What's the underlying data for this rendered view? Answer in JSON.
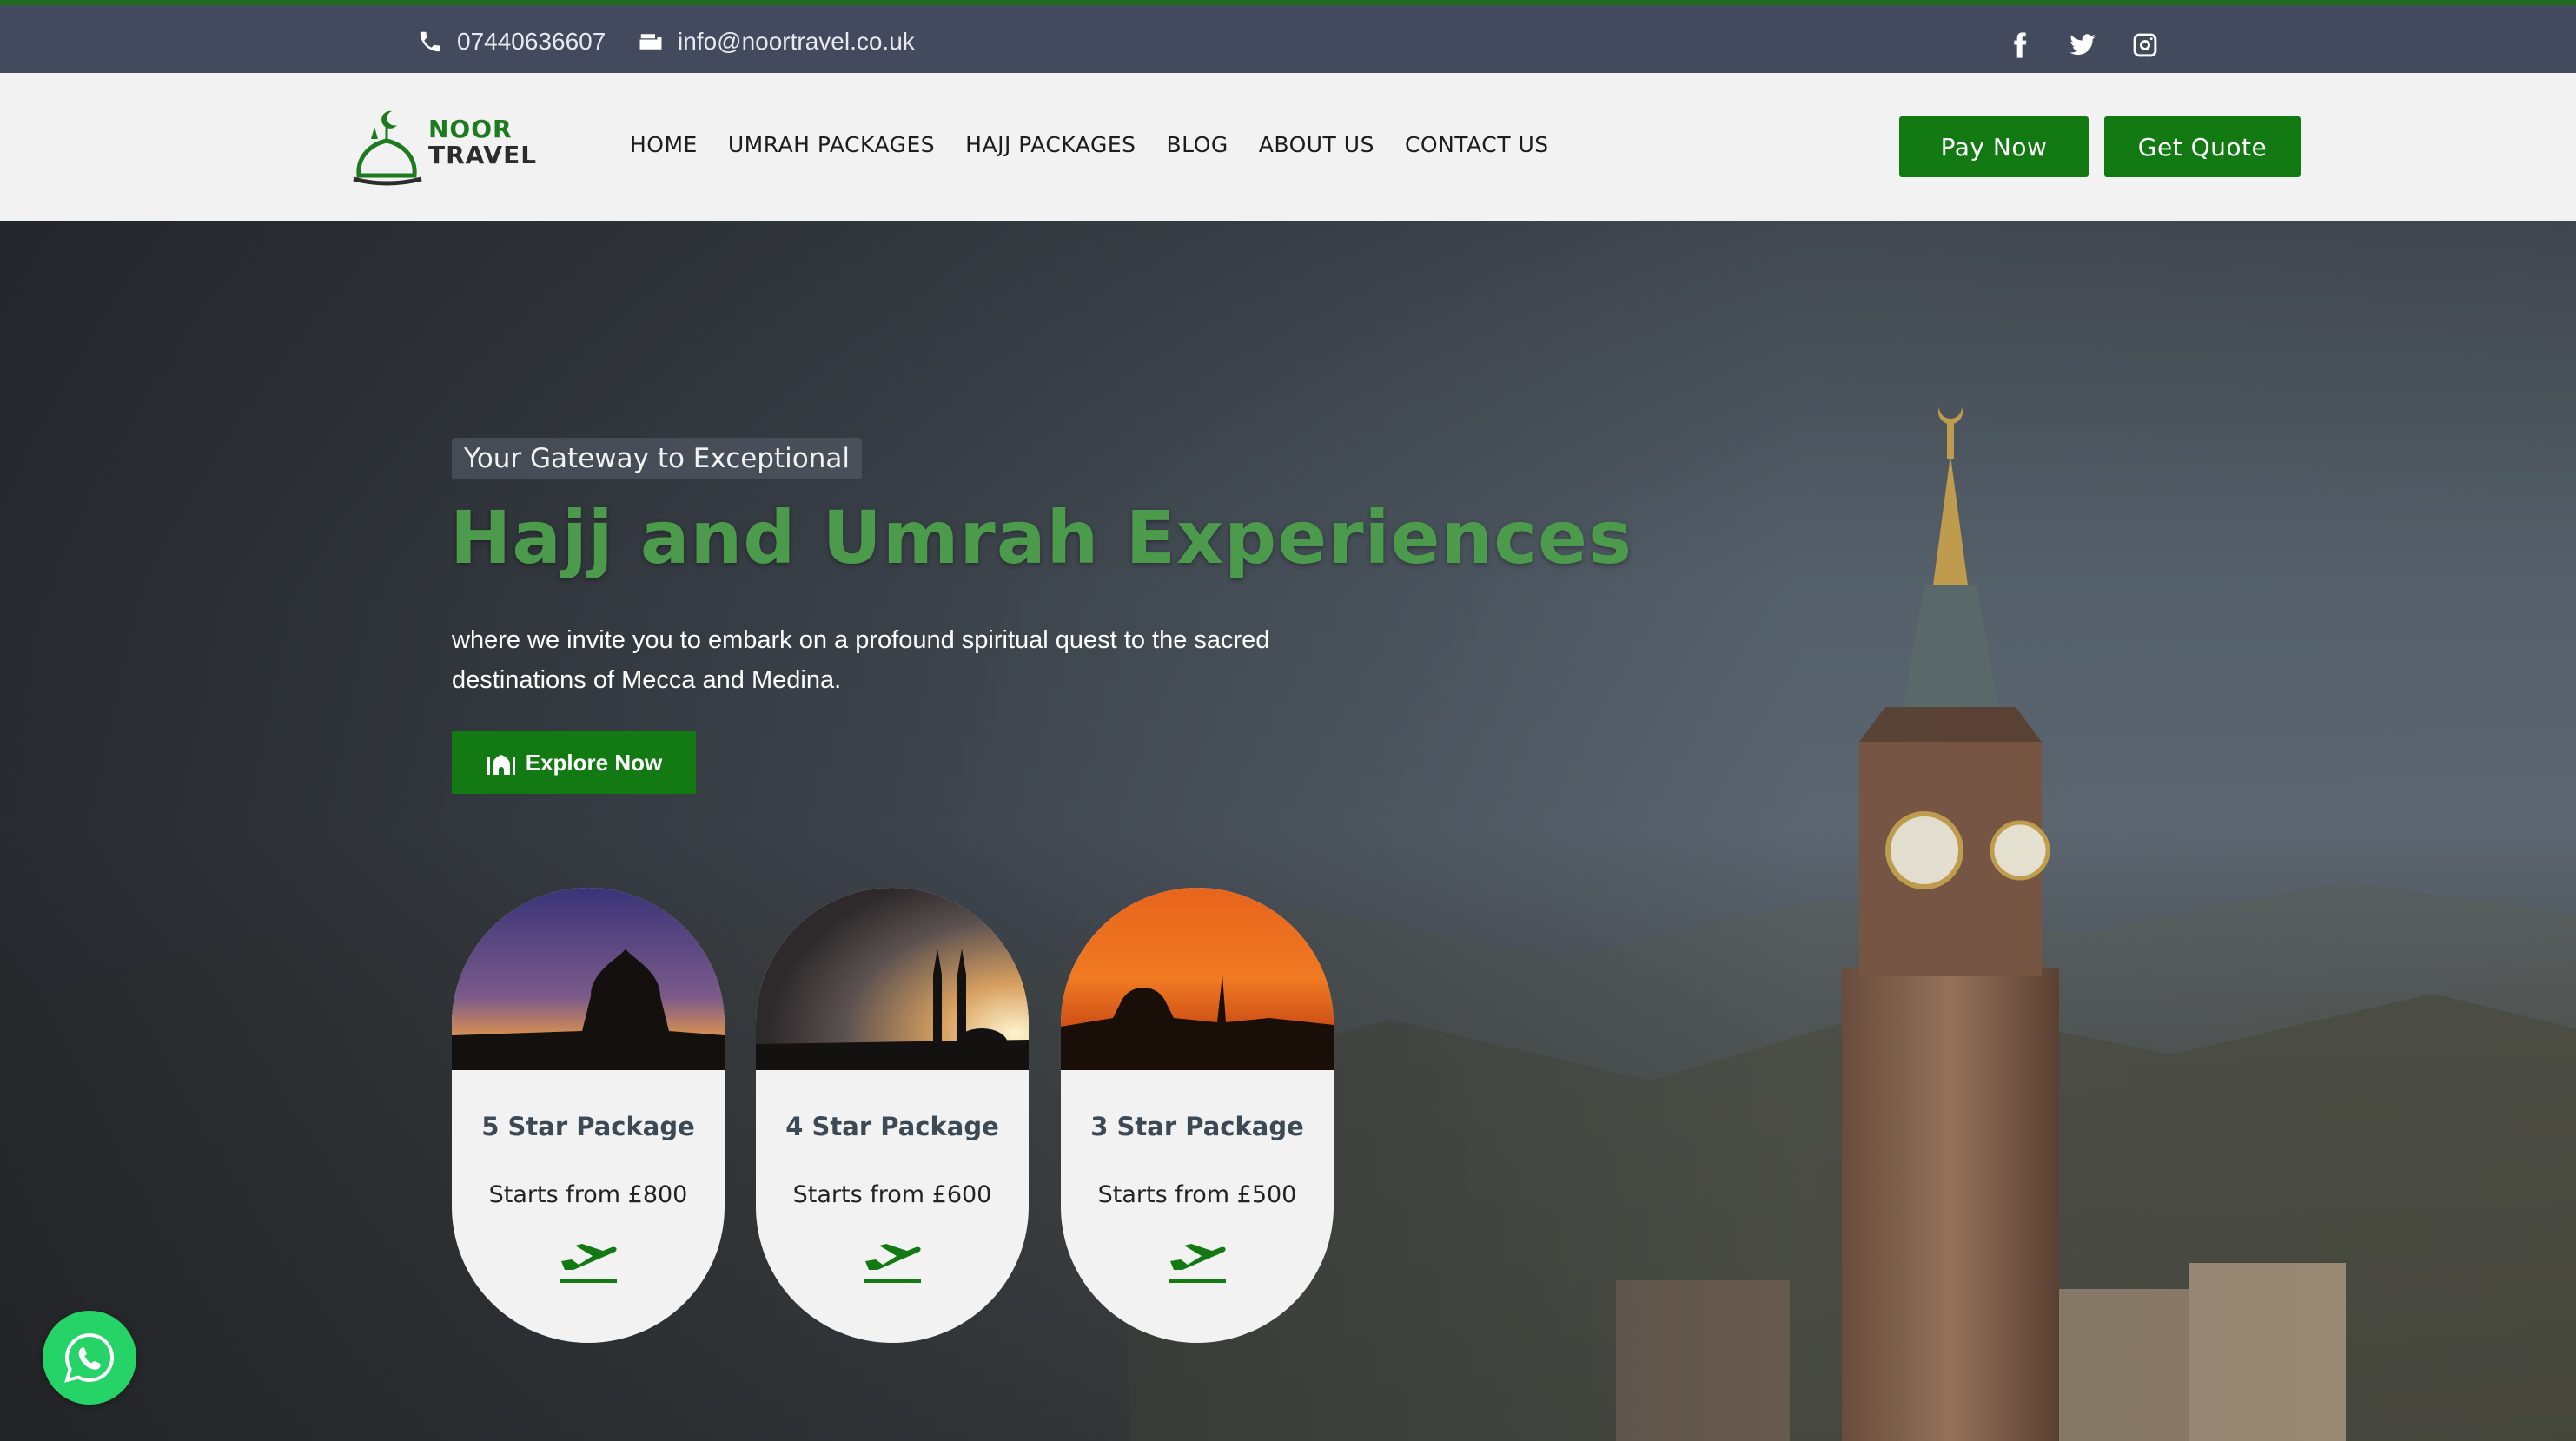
{
  "topbar": {
    "phone": "07440636607",
    "email": "info@noortravel.co.uk",
    "social": [
      "facebook-icon",
      "twitter-icon",
      "instagram-icon"
    ]
  },
  "logo": {
    "line1": "NOOR",
    "line2": "TRAVEL"
  },
  "nav": {
    "items": [
      "HOME",
      "UMRAH PACKAGES",
      "HAJJ PACKAGES",
      "BLOG",
      "ABOUT US",
      "CONTACT US"
    ],
    "pay_label": "Pay Now",
    "quote_label": "Get Quote"
  },
  "hero": {
    "tagline": "Your Gateway to Exceptional",
    "headline": "Hajj and Umrah Experiences",
    "description": "where we invite you to embark on a profound spiritual quest to the sacred destinations of Mecca and Medina.",
    "cta_label": "Explore Now"
  },
  "packages": [
    {
      "title": "5 Star Package",
      "price": "Starts from £800"
    },
    {
      "title": "4 Star Package",
      "price": "Starts from £600"
    },
    {
      "title": "3 Star Package",
      "price": "Starts from £500"
    }
  ],
  "colors": {
    "brand_green": "#137a13",
    "headline_green": "#4c9a4c",
    "topbar": "#434a5e",
    "whatsapp": "#25d366"
  }
}
